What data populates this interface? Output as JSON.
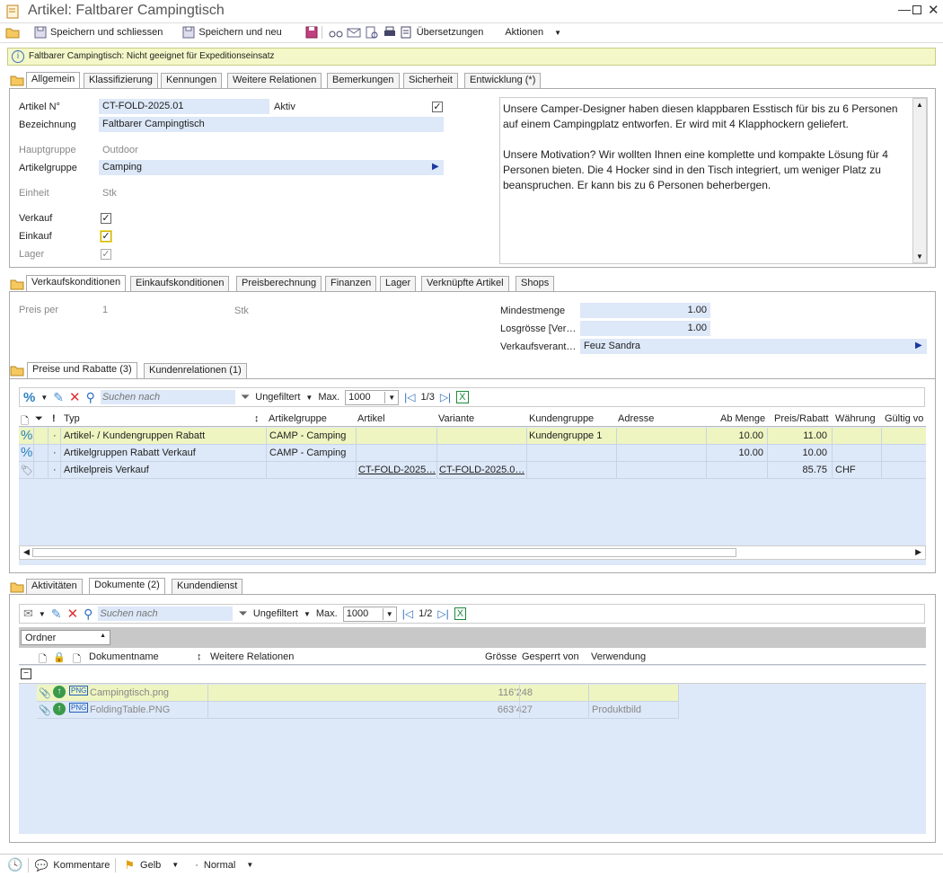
{
  "window": {
    "title": "Artikel: Faltbarer Campingtisch"
  },
  "toolbar": {
    "save_close": "Speichern und schliessen",
    "save_new": "Speichern und neu",
    "translations": "Übersetzungen",
    "actions": "Aktionen"
  },
  "info_bar": {
    "text": "Faltbarer Campingtisch: Nicht geeignet für Expeditionseinsatz"
  },
  "tabs1": [
    "Allgemein",
    "Klassifizierung",
    "Kennungen",
    "Weitere Relationen",
    "Bemerkungen",
    "Sicherheit",
    "Entwicklung (*)"
  ],
  "general": {
    "artikel_nr_label": "Artikel N°",
    "artikel_nr": "CT-FOLD-2025.01",
    "aktiv_label": "Aktiv",
    "bezeichnung_label": "Bezeichnung",
    "bezeichnung": "Faltbarer Campingtisch",
    "hauptgruppe_label": "Hauptgruppe",
    "hauptgruppe": "Outdoor",
    "artikelgruppe_label": "Artikelgruppe",
    "artikelgruppe": "Camping",
    "einheit_label": "Einheit",
    "einheit": "Stk",
    "verkauf_label": "Verkauf",
    "einkauf_label": "Einkauf",
    "lager_label": "Lager",
    "description": "Unsere Camper-Designer haben diesen klappbaren Esstisch für bis zu 6 Personen auf einem Campingplatz entworfen. Er wird mit 4 Klapphockern geliefert.\n\nUnsere Motivation? Wir wollten Ihnen eine komplette und kompakte Lösung für 4 Personen bieten. Die 4 Hocker sind in den Tisch integriert, um weniger Platz zu beanspruchen. Er kann bis zu 6 Personen beherbergen."
  },
  "tabs2": [
    "Verkaufskonditionen",
    "Einkaufskonditionen",
    "Preisberechnung",
    "Finanzen",
    "Lager",
    "Verknüpfte Artikel",
    "Shops"
  ],
  "sales": {
    "preis_per_label": "Preis per",
    "preis_per": "1",
    "unit": "Stk",
    "mindest_label": "Mindestmenge",
    "mindest": "1.00",
    "los_label": "Losgrösse [Ver…",
    "los": "1.00",
    "verant_label": "Verkaufsverant…",
    "verant": "Feuz Sandra"
  },
  "tabs3": [
    "Preise und Rabatte (3)",
    "Kundenrelationen (1)"
  ],
  "grid_toolbar": {
    "search_placeholder": "Suchen nach",
    "filter": "Ungefiltert",
    "max_label": "Max.",
    "max": "1000",
    "page": "1/3"
  },
  "price_grid": {
    "headers": [
      "Typ",
      "Artikelgruppe",
      "Artikel",
      "Variante",
      "Kundengruppe",
      "Adresse",
      "Ab Menge",
      "Preis/Rabatt",
      "Währung",
      "Gültig vo"
    ],
    "rows": [
      {
        "typ": "Artikel- / Kundengruppen Rabatt",
        "gruppe": "CAMP  -  Camping",
        "artikel": "",
        "variante": "",
        "kundengruppe": "Kundengruppe 1",
        "adresse": "",
        "ab": "10.00",
        "preis": "11.00",
        "waehrung": ""
      },
      {
        "typ": "Artikelgruppen Rabatt Verkauf",
        "gruppe": "CAMP  -  Camping",
        "artikel": "",
        "variante": "",
        "kundengruppe": "",
        "adresse": "",
        "ab": "10.00",
        "preis": "10.00",
        "waehrung": ""
      },
      {
        "typ": "Artikelpreis Verkauf",
        "gruppe": "",
        "artikel": "CT-FOLD-2025…",
        "variante": "CT-FOLD-2025.0…",
        "kundengruppe": "",
        "adresse": "",
        "ab": "",
        "preis": "85.75",
        "waehrung": "CHF"
      }
    ]
  },
  "tabs4": [
    "Aktivitäten",
    "Dokumente (2)",
    "Kundendienst"
  ],
  "doc_toolbar": {
    "search_placeholder": "Suchen nach",
    "filter": "Ungefiltert",
    "max_label": "Max.",
    "max": "1000",
    "page": "1/2"
  },
  "doc_grid": {
    "group_label": "Ordner",
    "headers": [
      "Dokumentname",
      "Weitere Relationen",
      "Grösse",
      "Gesperrt von",
      "Verwendung"
    ],
    "rows": [
      {
        "name": "Campingtisch.png",
        "rel": "",
        "size": "116’248",
        "locked": "",
        "use": ""
      },
      {
        "name": "FoldingTable.PNG",
        "rel": "",
        "size": "663’427",
        "locked": "",
        "use": "Produktbild"
      }
    ]
  },
  "statusbar": {
    "comments": "Kommentare",
    "flag": "Gelb",
    "priority": "Normal"
  },
  "colors": {
    "field_bg": "#dde8f8",
    "highlight_row": "#eef5c0",
    "info_bg": "#f4f8c8",
    "grid_bg": "#dde8f8"
  }
}
